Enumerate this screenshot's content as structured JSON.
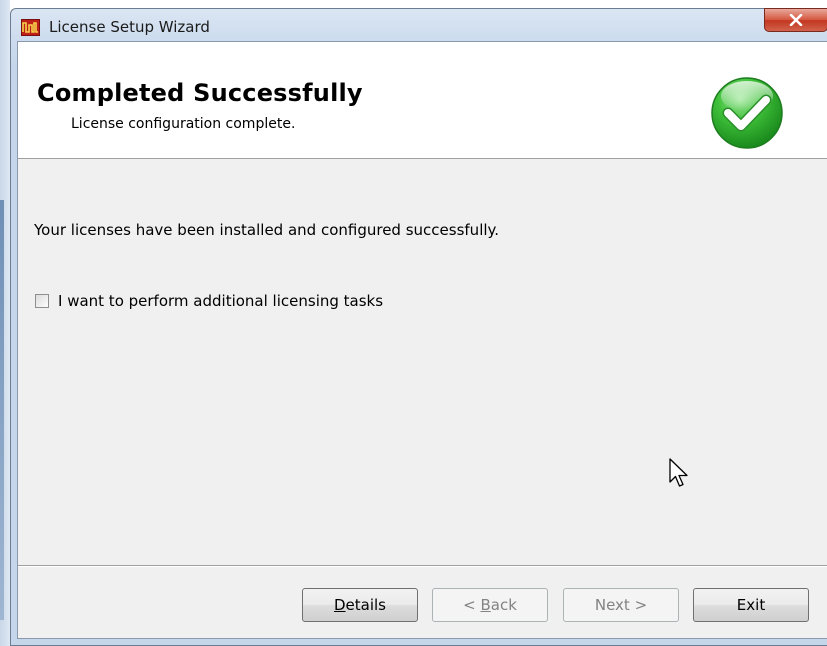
{
  "window": {
    "title": "License Setup Wizard",
    "close_label": "X"
  },
  "header": {
    "title": "Completed Successfully",
    "subtitle": "License configuration complete."
  },
  "body": {
    "message": "Your licenses have been installed and configured successfully.",
    "checkbox": {
      "label": "I want to perform additional licensing tasks",
      "checked": false
    }
  },
  "buttons": {
    "details": {
      "label": "Details",
      "accel": "D",
      "rest": "etails",
      "enabled": true
    },
    "back": {
      "label": "< Back",
      "prefix": "< ",
      "accel": "B",
      "rest": "ack",
      "enabled": false
    },
    "next": {
      "label": "Next >",
      "enabled": false
    },
    "exit": {
      "label": "Exit",
      "enabled": true
    }
  },
  "icons": {
    "app": "license-wizard-app-icon",
    "status": "success-check-icon",
    "cursor": "mouse-pointer-icon"
  },
  "colors": {
    "success_green": "#2bb52b",
    "close_red": "#c9402a",
    "app_icon_red": "#c0201a"
  }
}
